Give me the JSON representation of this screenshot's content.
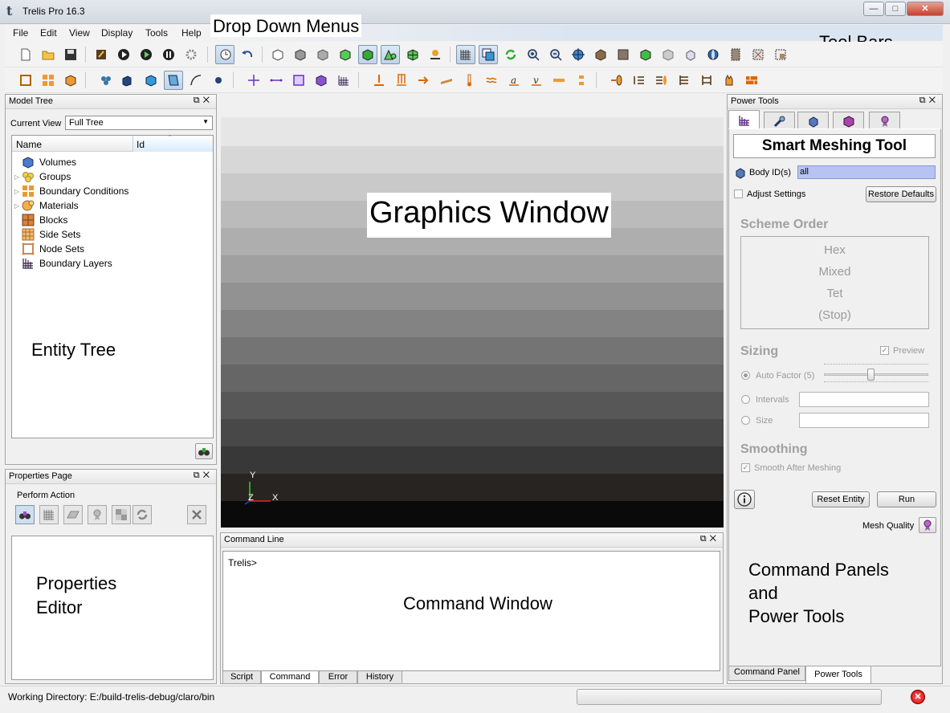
{
  "app": {
    "title": "Trelis Pro  16.3"
  },
  "window_controls": {
    "minimize": "—",
    "maximize": "□",
    "close": "✕"
  },
  "menu": [
    "File",
    "Edit",
    "View",
    "Display",
    "Tools",
    "Help"
  ],
  "annotations": {
    "dropdown_menus": "Drop Down Menus",
    "tool_bars": "Tool Bars",
    "graphics_window": "Graphics Window",
    "entity_tree": "Entity Tree",
    "properties_editor_line1": "Properties",
    "properties_editor_line2": "Editor",
    "command_window": "Command Window",
    "command_panels_line1": "Command Panels",
    "command_panels_line2": "and",
    "command_panels_line3": "Power Tools"
  },
  "model_tree": {
    "title": "Model Tree",
    "current_view_label": "Current View",
    "current_view_value": "Full Tree",
    "col_name": "Name",
    "col_id": "Id",
    "items": [
      {
        "label": "Volumes",
        "icon": "cube-icon",
        "expandable": false
      },
      {
        "label": "Groups",
        "icon": "groups-icon",
        "expandable": true
      },
      {
        "label": "Boundary Conditions",
        "icon": "boundary-conditions-icon",
        "expandable": true
      },
      {
        "label": "Materials",
        "icon": "materials-icon",
        "expandable": true
      },
      {
        "label": "Blocks",
        "icon": "blocks-icon",
        "expandable": false
      },
      {
        "label": "Side Sets",
        "icon": "side-sets-icon",
        "expandable": false
      },
      {
        "label": "Node Sets",
        "icon": "node-sets-icon",
        "expandable": false
      },
      {
        "label": "Boundary Layers",
        "icon": "boundary-layers-icon",
        "expandable": false
      }
    ]
  },
  "properties_page": {
    "title": "Properties Page",
    "perform_action_label": "Perform Action"
  },
  "command_line": {
    "title": "Command Line",
    "prompt": "Trelis>",
    "tabs": [
      "Script",
      "Command",
      "Error",
      "History"
    ],
    "active_tab": "Command"
  },
  "status_bar": {
    "working_directory": "Working Directory: E:/build-trelis-debug/claro/bin"
  },
  "axes": {
    "x": "X",
    "y": "Y",
    "z": "Z"
  },
  "power_tools": {
    "title": "Power Tools",
    "tool_title": "Smart Meshing Tool",
    "body_ids_label": "Body ID(s)",
    "body_ids_value": "all",
    "adjust_settings": "Adjust Settings",
    "restore_defaults": "Restore Defaults",
    "scheme_order_title": "Scheme Order",
    "scheme_order": [
      "Hex",
      "Mixed",
      "Tet",
      "(Stop)"
    ],
    "sizing_title": "Sizing",
    "preview": "Preview",
    "auto_factor": "Auto Factor (5)",
    "auto_factor_value": 5,
    "intervals": "Intervals",
    "size": "Size",
    "smoothing_title": "Smoothing",
    "smooth_after_meshing": "Smooth After Meshing",
    "reset_entity": "Reset Entity",
    "run": "Run",
    "mesh_quality": "Mesh Quality",
    "bottom_tabs": [
      "Command Panel",
      "Power Tools"
    ],
    "active_bottom_tab": "Power Tools"
  }
}
